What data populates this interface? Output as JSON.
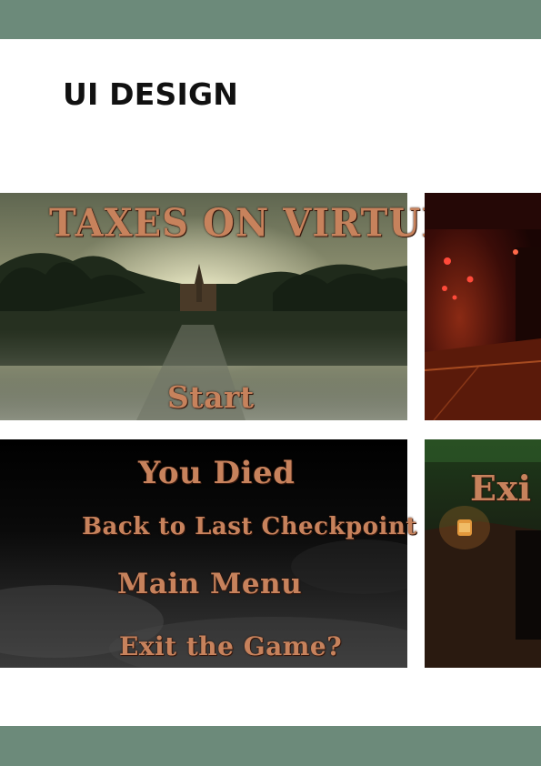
{
  "page": {
    "title": "UI DESIGN"
  },
  "screens": {
    "title_screen": {
      "game_title": "TAXES ON VIRTUE",
      "start_label": "Start"
    },
    "death_screen": {
      "heading": "You Died",
      "options": [
        "Back to Last Checkpoint",
        "Main Menu",
        "Exit the Game?"
      ]
    },
    "exit_screen": {
      "heading_partial": "Exi"
    }
  },
  "colors": {
    "band": "#6c8a7a",
    "menu_text": "#c7825c",
    "title_text": "#111111"
  }
}
